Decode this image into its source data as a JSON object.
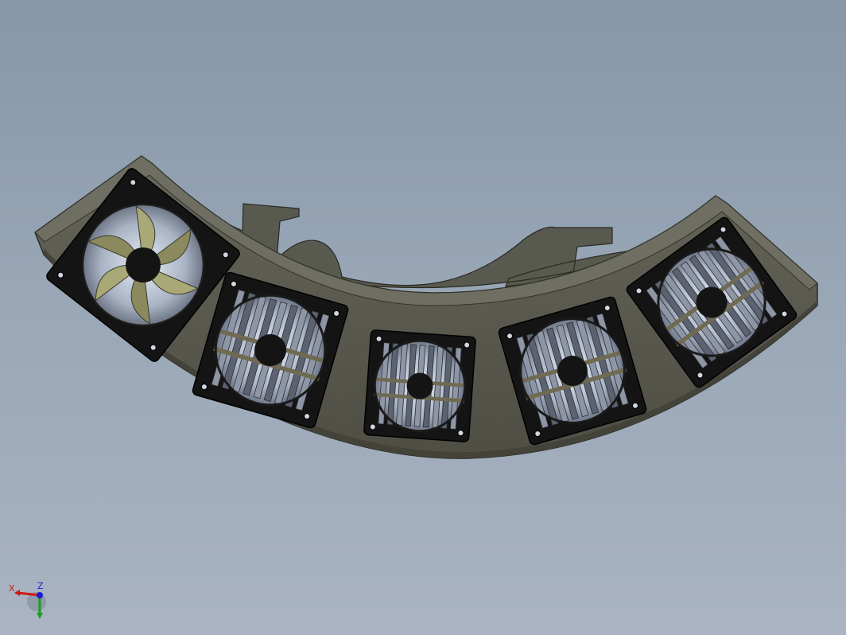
{
  "viewport": {
    "background_top": "#8797a8",
    "background_bottom": "#aab4c2"
  },
  "model": {
    "bracket_color": "#5b5a4e",
    "bracket_edge_color": "#2e2e26",
    "fan_frame_color": "#141414",
    "fan_count": 5
  },
  "triad": {
    "x_label": "X",
    "z_label": "Z",
    "x_color": "#d01818",
    "y_color": "#18a018",
    "z_color": "#1a1ad0"
  }
}
